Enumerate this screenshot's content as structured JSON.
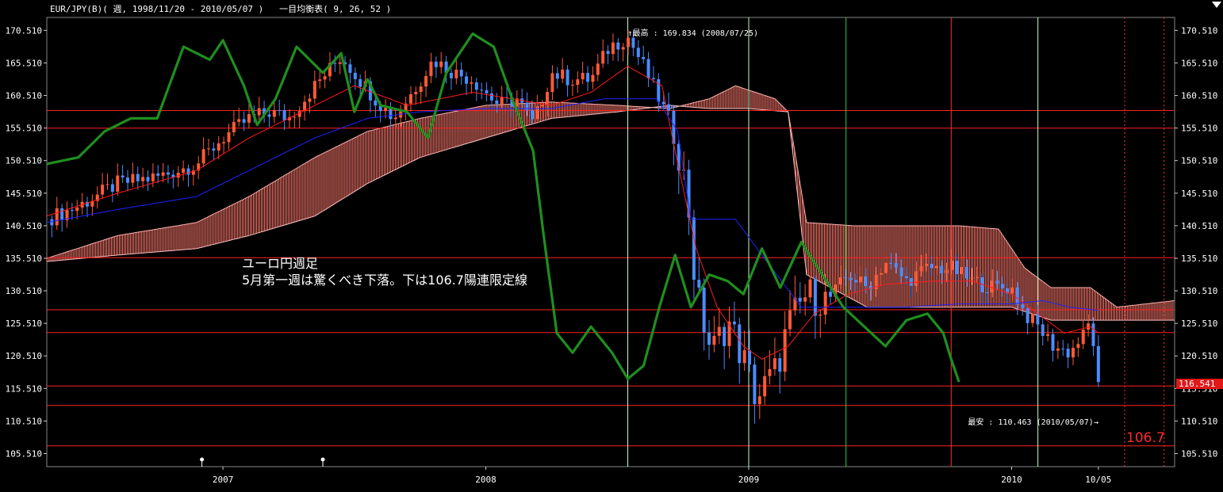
{
  "header": {
    "symbol_text": "EUR/JPY(B)( 週, 1998/11/20 - 2010/05/07 )",
    "indicator_text": "一目均衡表( 9, 26, 52 )"
  },
  "annotations": {
    "high_label": "↑最高 : 169.834 (2008/07/25)",
    "low_label": "最安 : 110.463 (2010/05/07)→",
    "note_line1": "ユーロ円週足",
    "note_line2": "5月第一週は驚くべき下落。下は106.7陽連限定線",
    "target_label": "106.7",
    "current_price": "116.541"
  },
  "colors": {
    "up_candle": "#ff5a36",
    "down_candle": "#4b8cff",
    "tenkan": "#ff1a1a",
    "kijun": "#1e22ff",
    "chikou": "#1f8f1f",
    "cloud_red": "#ff7a6e",
    "cloud_blue": "#8c9aff",
    "hline": "#ff2020",
    "vline_white": "#c8ffc8",
    "vline_green": "#2ecc40",
    "vline_red": "#ff3030"
  },
  "chart_data": {
    "type": "candlestick",
    "ylim": [
      103.5,
      172.5
    ],
    "yticks": [
      "170.510",
      "165.510",
      "160.510",
      "155.510",
      "150.510",
      "145.510",
      "140.510",
      "135.510",
      "130.510",
      "125.510",
      "120.510",
      "115.510",
      "110.510",
      "105.510"
    ],
    "ytick_values": [
      170.51,
      165.51,
      160.51,
      155.51,
      150.51,
      145.51,
      140.51,
      135.51,
      130.51,
      125.51,
      120.51,
      115.51,
      110.51,
      105.51
    ],
    "xlim": [
      2006.33,
      2010.62
    ],
    "xticks": [
      {
        "label": "2007",
        "t": 2007.0
      },
      {
        "label": "2008",
        "t": 2008.0
      },
      {
        "label": "2009",
        "t": 2009.0
      },
      {
        "label": "2010",
        "t": 2010.0
      },
      {
        "label": "10/05",
        "t": 2010.33
      }
    ],
    "horizontal_lines": [
      158.2,
      155.5,
      135.6,
      127.6,
      124.1,
      115.9,
      112.9,
      106.7
    ],
    "vertical_lines": [
      {
        "t": 2008.54,
        "style": "white"
      },
      {
        "t": 2009.0,
        "style": "white"
      },
      {
        "t": 2009.37,
        "style": "green"
      },
      {
        "t": 2009.77,
        "style": "red"
      },
      {
        "t": 2010.1,
        "style": "white"
      },
      {
        "t": 2010.43,
        "style": "red-dotted"
      },
      {
        "t": 2010.58,
        "style": "red-dotted"
      }
    ],
    "markers": [
      2006.92,
      2007.38
    ],
    "close_anchors": [
      [
        2006.33,
        141.5
      ],
      [
        2006.45,
        143.5
      ],
      [
        2006.6,
        147
      ],
      [
        2006.75,
        148
      ],
      [
        2006.9,
        150
      ],
      [
        2007.0,
        154
      ],
      [
        2007.1,
        157
      ],
      [
        2007.18,
        158
      ],
      [
        2007.25,
        157
      ],
      [
        2007.35,
        162
      ],
      [
        2007.45,
        166.5
      ],
      [
        2007.52,
        163
      ],
      [
        2007.58,
        160
      ],
      [
        2007.65,
        157
      ],
      [
        2007.72,
        161
      ],
      [
        2007.8,
        166
      ],
      [
        2007.88,
        164
      ],
      [
        2007.95,
        163
      ],
      [
        2008.05,
        159
      ],
      [
        2008.12,
        160
      ],
      [
        2008.18,
        156
      ],
      [
        2008.25,
        164
      ],
      [
        2008.32,
        163
      ],
      [
        2008.4,
        163
      ],
      [
        2008.47,
        168
      ],
      [
        2008.54,
        169.5
      ],
      [
        2008.6,
        165
      ],
      [
        2008.67,
        159
      ],
      [
        2008.72,
        155
      ],
      [
        2008.77,
        144
      ],
      [
        2008.8,
        130
      ],
      [
        2008.86,
        121
      ],
      [
        2008.92,
        126
      ],
      [
        2008.98,
        120
      ],
      [
        2009.03,
        114
      ],
      [
        2009.1,
        118
      ],
      [
        2009.15,
        125
      ],
      [
        2009.22,
        130
      ],
      [
        2009.3,
        129
      ],
      [
        2009.38,
        133
      ],
      [
        2009.45,
        131
      ],
      [
        2009.52,
        135
      ],
      [
        2009.6,
        132
      ],
      [
        2009.68,
        134
      ],
      [
        2009.77,
        134
      ],
      [
        2009.85,
        132
      ],
      [
        2009.93,
        131
      ],
      [
        2010.0,
        131
      ],
      [
        2010.05,
        127
      ],
      [
        2010.1,
        125
      ],
      [
        2010.16,
        122
      ],
      [
        2010.22,
        121
      ],
      [
        2010.28,
        124
      ],
      [
        2010.3,
        126
      ],
      [
        2010.33,
        116.5
      ]
    ],
    "tenkan_anchors": [
      [
        2006.33,
        142
      ],
      [
        2006.6,
        145.5
      ],
      [
        2006.9,
        149
      ],
      [
        2007.1,
        154
      ],
      [
        2007.35,
        159
      ],
      [
        2007.5,
        162
      ],
      [
        2007.7,
        159
      ],
      [
        2007.95,
        161
      ],
      [
        2008.1,
        160
      ],
      [
        2008.25,
        159
      ],
      [
        2008.4,
        161
      ],
      [
        2008.54,
        165
      ],
      [
        2008.67,
        162
      ],
      [
        2008.72,
        152
      ],
      [
        2008.8,
        137
      ],
      [
        2008.88,
        128
      ],
      [
        2008.98,
        122
      ],
      [
        2009.05,
        120
      ],
      [
        2009.15,
        122
      ],
      [
        2009.25,
        127
      ],
      [
        2009.38,
        130
      ],
      [
        2009.52,
        131.5
      ],
      [
        2009.7,
        132
      ],
      [
        2009.85,
        132
      ],
      [
        2010.0,
        130
      ],
      [
        2010.1,
        127
      ],
      [
        2010.2,
        124
      ],
      [
        2010.3,
        125
      ],
      [
        2010.33,
        124
      ]
    ],
    "kijun_anchors": [
      [
        2006.33,
        141
      ],
      [
        2006.6,
        143
      ],
      [
        2006.9,
        145
      ],
      [
        2007.1,
        149
      ],
      [
        2007.35,
        154
      ],
      [
        2007.55,
        157
      ],
      [
        2007.75,
        158
      ],
      [
        2008.0,
        158.5
      ],
      [
        2008.25,
        158.5
      ],
      [
        2008.45,
        160
      ],
      [
        2008.65,
        160
      ],
      [
        2008.73,
        155
      ],
      [
        2008.78,
        141.5
      ],
      [
        2008.95,
        141.5
      ],
      [
        2009.05,
        136
      ],
      [
        2009.2,
        128
      ],
      [
        2009.4,
        128
      ],
      [
        2009.6,
        128
      ],
      [
        2009.8,
        128.5
      ],
      [
        2010.0,
        128.5
      ],
      [
        2010.12,
        129
      ],
      [
        2010.22,
        128
      ],
      [
        2010.33,
        127.5
      ]
    ],
    "cloud_a_anchors": [
      [
        2006.33,
        135.5
      ],
      [
        2006.6,
        139
      ],
      [
        2006.9,
        141
      ],
      [
        2007.1,
        145
      ],
      [
        2007.35,
        151
      ],
      [
        2007.55,
        155
      ],
      [
        2007.75,
        157
      ],
      [
        2008.0,
        159
      ],
      [
        2008.25,
        159.5
      ],
      [
        2008.5,
        159
      ],
      [
        2008.7,
        158.5
      ],
      [
        2008.85,
        160
      ],
      [
        2008.95,
        162
      ],
      [
        2009.1,
        160
      ],
      [
        2009.15,
        158
      ],
      [
        2009.22,
        141
      ],
      [
        2009.4,
        140.5
      ],
      [
        2009.6,
        140.5
      ],
      [
        2009.8,
        140.5
      ],
      [
        2009.95,
        140
      ],
      [
        2010.05,
        134
      ],
      [
        2010.15,
        131
      ],
      [
        2010.3,
        131
      ],
      [
        2010.4,
        128
      ],
      [
        2010.62,
        129
      ]
    ],
    "cloud_b_anchors": [
      [
        2006.33,
        135
      ],
      [
        2006.6,
        136
      ],
      [
        2006.9,
        137
      ],
      [
        2007.1,
        139
      ],
      [
        2007.35,
        142
      ],
      [
        2007.55,
        147
      ],
      [
        2007.75,
        151
      ],
      [
        2008.0,
        154
      ],
      [
        2008.25,
        157
      ],
      [
        2008.5,
        158
      ],
      [
        2008.7,
        159
      ],
      [
        2008.85,
        158.5
      ],
      [
        2009.0,
        158.5
      ],
      [
        2009.15,
        158
      ],
      [
        2009.22,
        133
      ],
      [
        2009.45,
        128
      ],
      [
        2009.65,
        128
      ],
      [
        2009.85,
        128
      ],
      [
        2010.0,
        128
      ],
      [
        2010.15,
        126
      ],
      [
        2010.3,
        126
      ],
      [
        2010.45,
        126
      ],
      [
        2010.62,
        126
      ]
    ],
    "chikou_anchors": [
      [
        2006.33,
        150
      ],
      [
        2006.45,
        151
      ],
      [
        2006.55,
        155
      ],
      [
        2006.65,
        157
      ],
      [
        2006.75,
        157
      ],
      [
        2006.85,
        168
      ],
      [
        2006.95,
        166
      ],
      [
        2007.0,
        169
      ],
      [
        2007.08,
        162
      ],
      [
        2007.13,
        156
      ],
      [
        2007.2,
        160
      ],
      [
        2007.28,
        168
      ],
      [
        2007.38,
        164
      ],
      [
        2007.45,
        167
      ],
      [
        2007.5,
        158
      ],
      [
        2007.55,
        163
      ],
      [
        2007.6,
        159
      ],
      [
        2007.7,
        158
      ],
      [
        2007.78,
        154
      ],
      [
        2007.85,
        164
      ],
      [
        2007.95,
        170
      ],
      [
        2008.03,
        168
      ],
      [
        2008.1,
        160
      ],
      [
        2008.18,
        152
      ],
      [
        2008.22,
        139
      ],
      [
        2008.27,
        124
      ],
      [
        2008.33,
        121
      ],
      [
        2008.4,
        125
      ],
      [
        2008.48,
        121
      ],
      [
        2008.54,
        117
      ],
      [
        2008.6,
        119
      ],
      [
        2008.66,
        128
      ],
      [
        2008.72,
        136
      ],
      [
        2008.78,
        128
      ],
      [
        2008.85,
        133
      ],
      [
        2008.92,
        132
      ],
      [
        2008.98,
        130
      ],
      [
        2009.05,
        137
      ],
      [
        2009.12,
        131
      ],
      [
        2009.2,
        138
      ],
      [
        2009.28,
        133
      ],
      [
        2009.36,
        128
      ],
      [
        2009.44,
        125
      ],
      [
        2009.52,
        122
      ],
      [
        2009.6,
        126
      ],
      [
        2009.68,
        127
      ],
      [
        2009.74,
        124
      ],
      [
        2009.77,
        120
      ],
      [
        2009.8,
        116.5
      ]
    ]
  }
}
